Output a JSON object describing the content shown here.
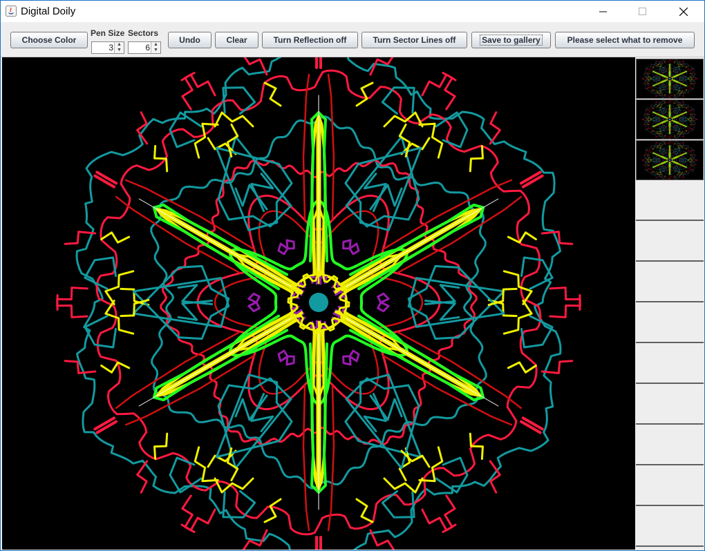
{
  "window": {
    "title": "Digital Doily"
  },
  "toolbar": {
    "choose_color": "Choose Color",
    "pen_size_label": "Pen Size",
    "pen_size_value": "3",
    "sectors_label": "Sectors",
    "sectors_value": "6",
    "undo": "Undo",
    "clear": "Clear",
    "reflection": "Turn Reflection off",
    "sector_lines": "Turn Sector Lines off",
    "save": "Save to gallery",
    "remove": "Please select what to remove"
  },
  "canvas": {
    "background": "#000000",
    "sectors": 6,
    "reflection": true,
    "sector_lines": true,
    "colors": {
      "teal": "#139aa0",
      "red": "#ff1a40",
      "yellow": "#f0f000",
      "lime": "#22ff22",
      "purple": "#9a1cb0",
      "darkred": "#d01010"
    }
  },
  "gallery": {
    "saved_count": 3,
    "total_slots": 12
  }
}
